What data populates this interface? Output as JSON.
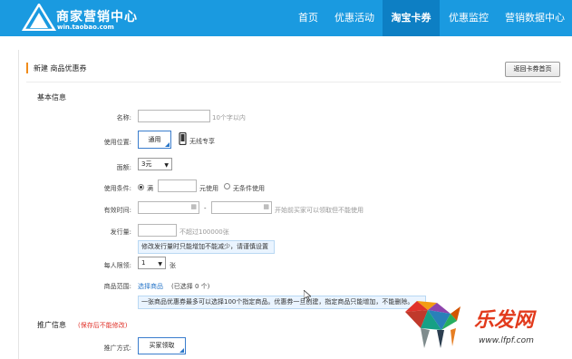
{
  "brand": {
    "title": "商家营销中心",
    "url": "win.taobao.com"
  },
  "nav": [
    {
      "label": "首页"
    },
    {
      "label": "优惠活动"
    },
    {
      "label": "淘宝卡券"
    },
    {
      "label": "优惠监控"
    },
    {
      "label": "营销数据中心"
    }
  ],
  "header": {
    "title": "新建 商品优惠券",
    "back_button": "返回卡券首页"
  },
  "basic": {
    "section": "基本信息",
    "name_label": "名称:",
    "name_hint": "10个字以内",
    "position_label": "使用位置:",
    "position_value": "通用",
    "mobile_label": "无线专享",
    "denomination_label": "面额:",
    "denomination_value": "3元",
    "condition_label": "使用条件:",
    "condition_full": "满",
    "condition_unit": "元使用",
    "condition_none": "无条件使用",
    "validity_label": "有效时间:",
    "validity_sep": "-",
    "validity_hint": "开始前买家可以领取但不能使用",
    "issue_label": "发行量:",
    "issue_hint": "不超过100000张",
    "issue_notice": "修改发行量时只能增加不能减少，请谨慎设置",
    "limit_label": "每人限领:",
    "limit_value": "1",
    "limit_unit": "张",
    "scope_label": "商品范围:",
    "scope_link": "选择商品",
    "scope_count": "(已选择 0 个)",
    "scope_notice": "一张商品优惠券最多可以选择100个指定商品。优惠券一旦创建，指定商品只能增加，不能删除。"
  },
  "promo": {
    "section": "推广信息",
    "section_note": "(保存后不能修改)",
    "method_label": "推广方式:",
    "method_value": "买家领取"
  },
  "watermark": {
    "text": "乐发网",
    "url": "www.lfpf.com"
  },
  "colors": {
    "topbar": "#1a9ae0",
    "accent": "#f08c1a",
    "link": "#2a77c9"
  }
}
